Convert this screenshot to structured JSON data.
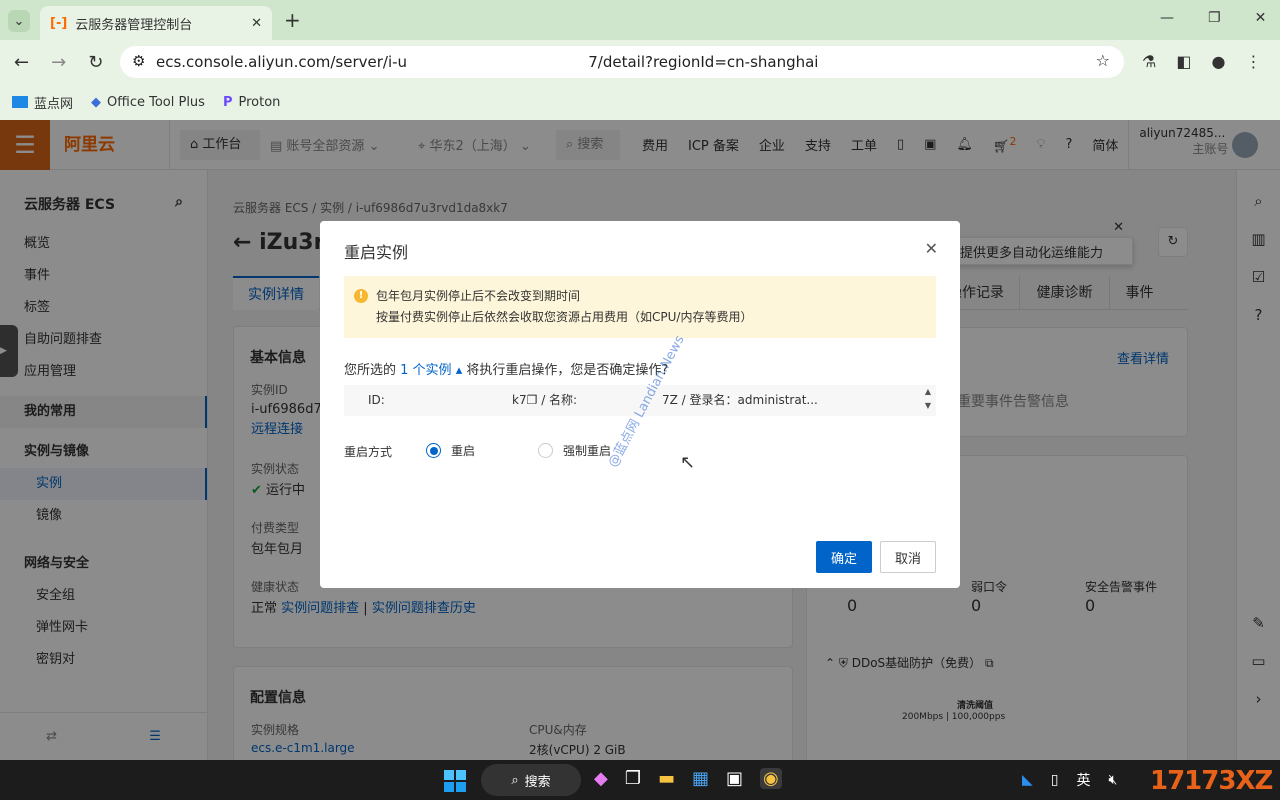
{
  "browser": {
    "tab_title": "云服务器管理控制台",
    "url": "ecs.console.aliyun.com/server/i-u                                      7/detail?regionId=cn-shanghai",
    "bookmarks": [
      {
        "label": "蓝点网",
        "icon": "landian-icon"
      },
      {
        "label": "Office Tool Plus",
        "icon": "office-icon"
      },
      {
        "label": "Proton",
        "icon": "proton-icon"
      }
    ]
  },
  "header": {
    "logo": "阿里云",
    "workbench": "工作台",
    "resources": "账号全部资源",
    "region": "华东2（上海）",
    "search": "搜索",
    "links": [
      "费用",
      "ICP 备案",
      "企业",
      "支持",
      "工单"
    ],
    "cart_badge": "2",
    "lang": "简体",
    "user": "aliyun72485...",
    "account_type": "主账号",
    "brand_color": "#ff6a00"
  },
  "sidebar": {
    "title": "云服务器 ECS",
    "items": [
      "概览",
      "事件",
      "标签",
      "自助问题排查",
      "应用管理"
    ],
    "groups": [
      {
        "label": "我的常用",
        "items": []
      },
      {
        "label": "实例与镜像",
        "items": [
          "实例",
          "镜像"
        ]
      },
      {
        "label": "网络与安全",
        "items": [
          "安全组",
          "弹性网卡",
          "密钥对"
        ]
      }
    ]
  },
  "content": {
    "breadcrumb": [
      "云服务器 ECS",
      "实例",
      "i-uf6986d7u3rvd1da8xk7"
    ],
    "title": "iZu3r",
    "tabs": [
      "实例详情",
      "操作记录",
      "健康诊断",
      "事件"
    ],
    "basic_title": "基本信息",
    "instance_id_label": "实例ID",
    "instance_id": "i-uf6986d7u3",
    "remote": "远程连接",
    "status_label": "实例状态",
    "status": "运行中",
    "billing_label": "付费类型",
    "billing": "包年包月",
    "health_label": "健康状态",
    "health": "正常",
    "troubleshoot": "实例问题排查",
    "troubleshoot_history": "实例问题排查历史",
    "config_title": "配置信息",
    "spec_label": "实例规格",
    "spec": "ecs.e-c1m1.large",
    "cpu_label": "CPU&内存",
    "cpu": "2核(vCPU)  2 GiB",
    "tip": "提供更多自动化运维能力",
    "view_details": "查看详情",
    "no_events": "重要事件告警信息",
    "security": [
      {
        "label": "弱口令",
        "value": "0"
      },
      {
        "label": "安全告警事件",
        "value": "0"
      }
    ],
    "first_value": "0",
    "ddos": "DDoS基础防护（免费）",
    "ddos_threshold": "清洗阈值",
    "ddos_values": "200Mbps | 100,000pps"
  },
  "modal": {
    "title": "重启实例",
    "warning_lines": [
      "包年包月实例停止后不会改变到期时间",
      "按量付费实例停止后依然会收取您资源占用费用（如CPU/内存等费用）"
    ],
    "question_prefix": "您所选的",
    "instance_count": "1 个实例",
    "question_suffix": "将执行重启操作，您是否确定操作?",
    "row": {
      "id_label": "ID:",
      "id_tail": "k7",
      "name_label": "/ 名称:",
      "name_tail": "7Z / 登录名：administrat..."
    },
    "mode_label": "重启方式",
    "options": [
      {
        "label": "重启",
        "selected": true
      },
      {
        "label": "强制重启",
        "selected": false
      }
    ],
    "confirm": "确定",
    "cancel": "取消"
  },
  "taskbar": {
    "search": "搜索",
    "ime": "英"
  },
  "watermark": {
    "text": "@蓝点网 Landian.News",
    "logo": "17173XZ"
  }
}
